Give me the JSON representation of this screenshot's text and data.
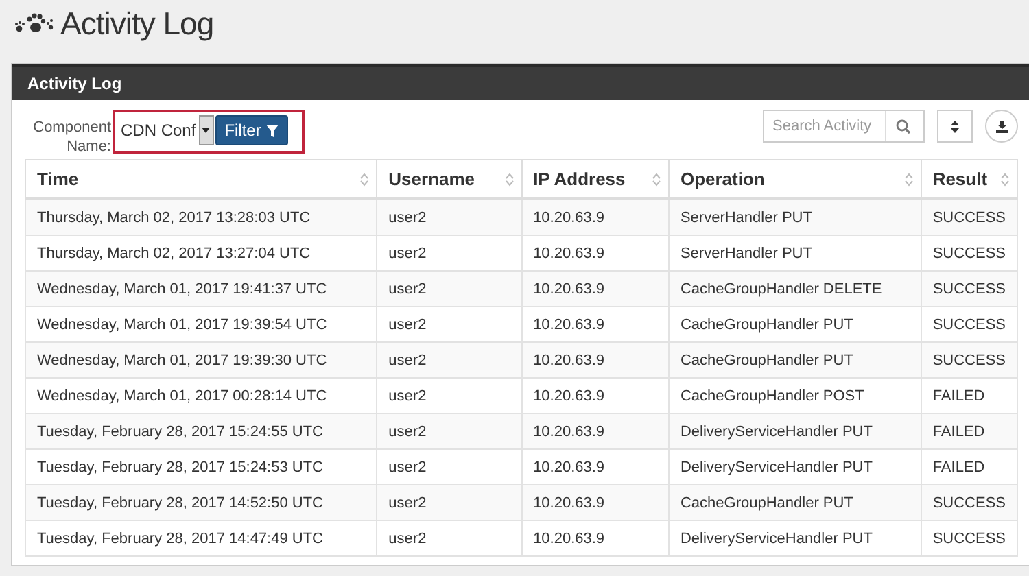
{
  "page": {
    "title": "Activity Log"
  },
  "panel": {
    "title": "Activity Log"
  },
  "filter": {
    "label": "Component Name:",
    "value": "CDN Conf",
    "button": "Filter"
  },
  "search": {
    "placeholder": "Search Activity"
  },
  "table": {
    "columns": [
      "Time",
      "Username",
      "IP Address",
      "Operation",
      "Result"
    ],
    "rows": [
      [
        "Thursday, March 02, 2017 13:28:03 UTC",
        "user2",
        "10.20.63.9",
        "ServerHandler PUT",
        "SUCCESS"
      ],
      [
        "Thursday, March 02, 2017 13:27:04 UTC",
        "user2",
        "10.20.63.9",
        "ServerHandler PUT",
        "SUCCESS"
      ],
      [
        "Wednesday, March 01, 2017 19:41:37 UTC",
        "user2",
        "10.20.63.9",
        "CacheGroupHandler DELETE",
        "SUCCESS"
      ],
      [
        "Wednesday, March 01, 2017 19:39:54 UTC",
        "user2",
        "10.20.63.9",
        "CacheGroupHandler PUT",
        "SUCCESS"
      ],
      [
        "Wednesday, March 01, 2017 19:39:30 UTC",
        "user2",
        "10.20.63.9",
        "CacheGroupHandler PUT",
        "SUCCESS"
      ],
      [
        "Wednesday, March 01, 2017 00:28:14 UTC",
        "user2",
        "10.20.63.9",
        "CacheGroupHandler POST",
        "FAILED"
      ],
      [
        "Tuesday, February 28, 2017 15:24:55 UTC",
        "user2",
        "10.20.63.9",
        "DeliveryServiceHandler PUT",
        "FAILED"
      ],
      [
        "Tuesday, February 28, 2017 15:24:53 UTC",
        "user2",
        "10.20.63.9",
        "DeliveryServiceHandler PUT",
        "FAILED"
      ],
      [
        "Tuesday, February 28, 2017 14:52:50 UTC",
        "user2",
        "10.20.63.9",
        "CacheGroupHandler PUT",
        "SUCCESS"
      ],
      [
        "Tuesday, February 28, 2017 14:47:49 UTC",
        "user2",
        "10.20.63.9",
        "DeliveryServiceHandler PUT",
        "SUCCESS"
      ]
    ]
  }
}
